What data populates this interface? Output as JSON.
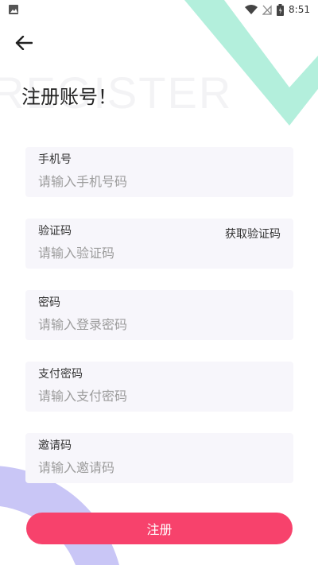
{
  "status_bar": {
    "time": "8:51"
  },
  "header": {
    "watermark": "REGISTER",
    "title": "注册账号！"
  },
  "form": {
    "phone": {
      "label": "手机号",
      "placeholder": "请输入手机号码"
    },
    "code": {
      "label": "验证码",
      "placeholder": "请输入验证码",
      "action": "获取验证码"
    },
    "password": {
      "label": "密码",
      "placeholder": "请输入登录密码"
    },
    "pay_password": {
      "label": "支付密码",
      "placeholder": "请输入支付密码"
    },
    "invite": {
      "label": "邀请码",
      "placeholder": "请输入邀请码"
    }
  },
  "submit_label": "注册",
  "colors": {
    "accent": "#f7426c",
    "field_bg": "#f7f6fb",
    "deco_green": "#b3efdc",
    "deco_purple": "#c9c6f6"
  }
}
